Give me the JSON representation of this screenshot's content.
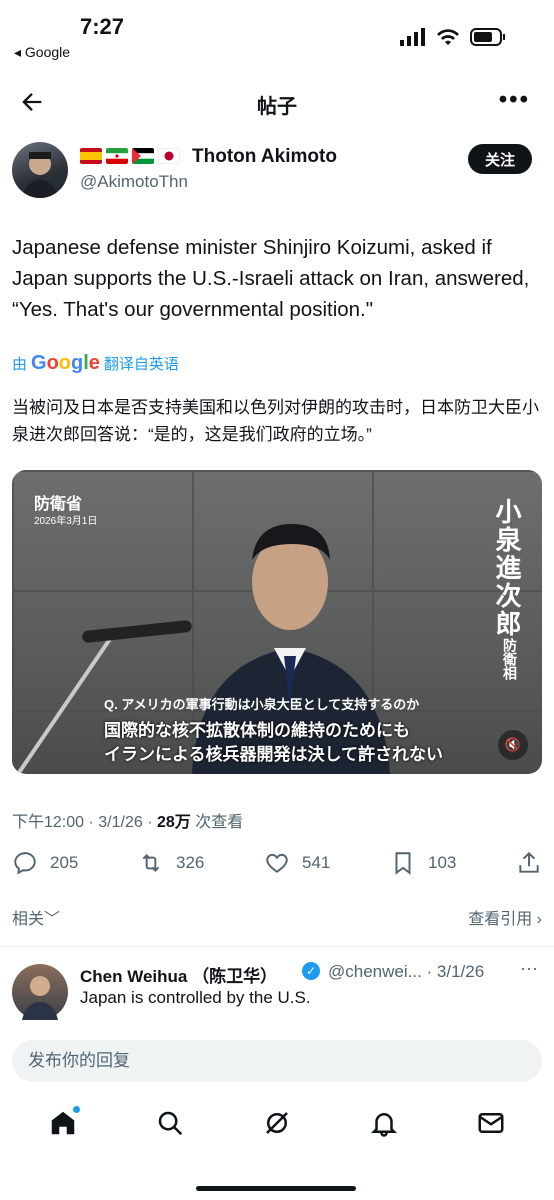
{
  "status_bar": {
    "time": "7:27",
    "back_app": "◂ Google"
  },
  "header": {
    "title": "帖子"
  },
  "author": {
    "name": "Thoton Akimoto",
    "handle": "@AkimotoThn",
    "flags": [
      "spain-flag",
      "iran-flag",
      "palestine-flag",
      "japan-flag"
    ],
    "follow_label": "关注"
  },
  "tweet": {
    "text": "Japanese defense minister Shinjiro Koizumi, asked if Japan supports the U.S.-Israeli attack on Iran, answered, “Yes. That's our governmental position.\"",
    "translated_by_prefix": "由",
    "translated_by_suffix": "翻译自英语",
    "translated_text": "当被问及日本是否支持美国和以色列对伊朗的攻击时，日本防卫大臣小泉进次郎回答说：“是的，这是我们政府的立场。”"
  },
  "media": {
    "ministry": "防衛省",
    "date": "2026年3月1日",
    "name_vertical": "小泉進次郎",
    "title_vertical": "防衛相",
    "subtitle_question": "Q. アメリカの軍事行動は小泉大臣として支持するのか",
    "subtitle_line1": "国際的な核不拡散体制の維持のためにも",
    "subtitle_line2": "イランによる核兵器開発は決して許されない"
  },
  "meta": {
    "time_date": "下午12:00 · 3/1/26 · ",
    "views": "28万",
    "views_label": " 次查看"
  },
  "actions": {
    "replies": "205",
    "reposts": "326",
    "likes": "541",
    "bookmarks": "103"
  },
  "related_label": "相关",
  "view_quotes_label": "查看引用",
  "reply": {
    "name": "Chen Weihua （陈卫华）",
    "handle_date": "@chenwei... · 3/1/26",
    "text": "Japan is controlled by the U.S."
  },
  "reply_box": {
    "placeholder": "发布你的回复"
  },
  "colors": {
    "accent": "#1d9bf0",
    "text": "#0f1419",
    "muted": "#536471"
  }
}
